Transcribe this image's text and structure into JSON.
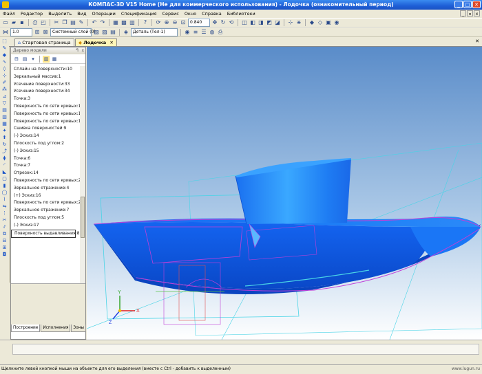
{
  "window": {
    "title": "КОМПАС-3D V15 Home (Не для коммерческого использования) - Лодочка (ознакомительный период)"
  },
  "menu": [
    "Файл",
    "Редактор",
    "Выделить",
    "Вид",
    "Операции",
    "Спецификация",
    "Сервис",
    "Окно",
    "Справка",
    "Библиотеки"
  ],
  "toolbar": {
    "zoom_value": "0.840",
    "scale_value": "1.0",
    "layer": "Системный слой (0)",
    "detail": "Деталь (Тел-1)"
  },
  "tabs": [
    {
      "label": "Стартовая страница",
      "active": false
    },
    {
      "label": "Лодочка",
      "active": true
    }
  ],
  "panel": {
    "title": "Дерево модели",
    "pin": "ꟼ",
    "close": "x",
    "items": [
      "Сплайн на поверхности:10",
      "Зеркальный массив:1",
      "Усечение поверхности:33",
      "Усечение поверхности:34",
      "Точка:3",
      "Поверхность по сети кривых:16",
      "Поверхность по сети кривых:17",
      "Поверхность по сети кривых:18",
      "Сшивка поверхностей:9",
      "(-) Эскиз:14",
      "Плоскость под углом:2",
      "(-) Эскиз:15",
      "Точка:6",
      "Точка:7",
      "Отрезок:14",
      "Поверхность по сети кривых:23",
      "Зеркальное отражение:4",
      "(+) Эскиз:16",
      "Поверхность по сети кривых:24",
      "Зеркальное отражение:7",
      "Плоскость под углом:5",
      "(-) Эскиз:17",
      "Поверхность выдавливания:8"
    ],
    "selected_index": 22,
    "bottom_tabs": [
      "Построение",
      "Исполнения",
      "Зоны"
    ]
  },
  "viewport": {
    "model_color": "#1e6ef2",
    "edge_color": "#c040d8",
    "axis_labels": {
      "x": "X",
      "y": "Y",
      "z": "Z"
    }
  },
  "status": {
    "text": "Щелкните левой кнопкой мыши на объекте для его выделения (вместе с Ctrl - добавить к выделенным)",
    "site": "www.lugun.ru"
  }
}
